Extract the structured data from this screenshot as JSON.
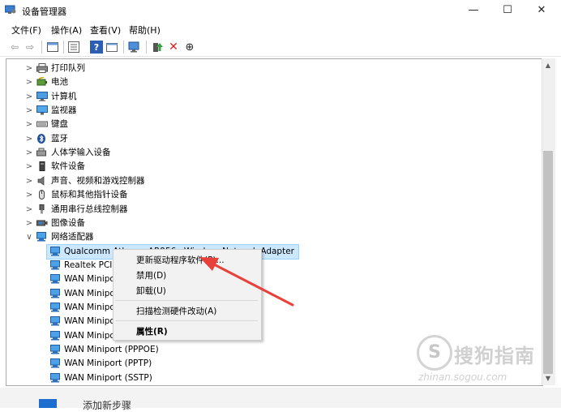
{
  "window": {
    "title": "设备管理器",
    "minimize": "—",
    "maximize": "☐",
    "close": "✕"
  },
  "menu": [
    "文件(F)",
    "操作(A)",
    "查看(V)",
    "帮助(H)"
  ],
  "toolbar": {
    "back": "⇦",
    "forward": "⇨",
    "help": "?",
    "remove": "✕",
    "download": "⊕"
  },
  "tree": {
    "categories": [
      {
        "label": "打印队列",
        "icon": "printer-icon"
      },
      {
        "label": "电池",
        "icon": "battery-icon"
      },
      {
        "label": "计算机",
        "icon": "computer-icon"
      },
      {
        "label": "监视器",
        "icon": "monitor-icon"
      },
      {
        "label": "键盘",
        "icon": "keyboard-icon"
      },
      {
        "label": "蓝牙",
        "icon": "bluetooth-icon"
      },
      {
        "label": "人体学输入设备",
        "icon": "hid-icon"
      },
      {
        "label": "软件设备",
        "icon": "software-device-icon"
      },
      {
        "label": "声音、视频和游戏控制器",
        "icon": "audio-icon"
      },
      {
        "label": "鼠标和其他指针设备",
        "icon": "mouse-icon"
      },
      {
        "label": "通用串行总线控制器",
        "icon": "usb-icon"
      },
      {
        "label": "图像设备",
        "icon": "camera-icon"
      }
    ],
    "expanded": {
      "label": "网络适配器",
      "icon": "network-adapter-icon"
    },
    "children": [
      "Qualcomm Atheros AR956x Wireless Network Adapter",
      "Realtek PCIe",
      "WAN Miniport",
      "WAN Miniport",
      "WAN Miniport",
      "WAN Miniport",
      "WAN Miniport",
      "WAN Miniport (PPPOE)",
      "WAN Miniport (PPTP)",
      "WAN Miniport (SSTP)"
    ]
  },
  "context_menu": {
    "update": "更新驱动程序软件(P)...",
    "disable": "禁用(D)",
    "uninstall": "卸载(U)",
    "scan": "扫描检测硬件改动(A)",
    "properties": "属性(R)"
  },
  "bottom": {
    "text": "添加新步骤"
  },
  "watermark": {
    "text": "搜狗指南",
    "url": "zhinan.sogou.com"
  },
  "colors": {
    "accent": "#0078d7",
    "selection": "#cce8ff",
    "arrow": "#e8403a"
  }
}
